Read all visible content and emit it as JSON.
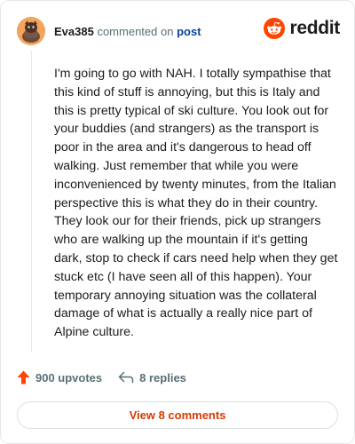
{
  "comment": {
    "author": "Eva385",
    "action_text": "commented on",
    "target_link": "post",
    "body": "I'm going to go with NAH. I totally sympathise that this kind of stuff is annoying, but this is Italy and this is pretty typical of ski culture. You look out for your buddies (and strangers) as the transport is poor in the area and it's dangerous to head off walking. Just remember that while you were inconvenienced by twenty minutes, from the Italian perspective this is what they do in their country. They look our for their friends, pick up strangers who are walking up the mountain if it's getting dark, stop to check if cars need help when they get stuck etc (I have seen all of this happen). Your temporary annoying situation was the collateral damage of what is actually a really nice part of Alpine culture.",
    "upvotes": "900 upvotes",
    "replies": "8 replies"
  },
  "brand": {
    "name": "reddit",
    "icon": "reddit-snoo-icon",
    "color": "#ff4500"
  },
  "footer": {
    "view_comments_label": "View 8 comments"
  },
  "colors": {
    "accent": "#d93a00",
    "link": "#0a449b",
    "upvote": "#ff4500"
  }
}
